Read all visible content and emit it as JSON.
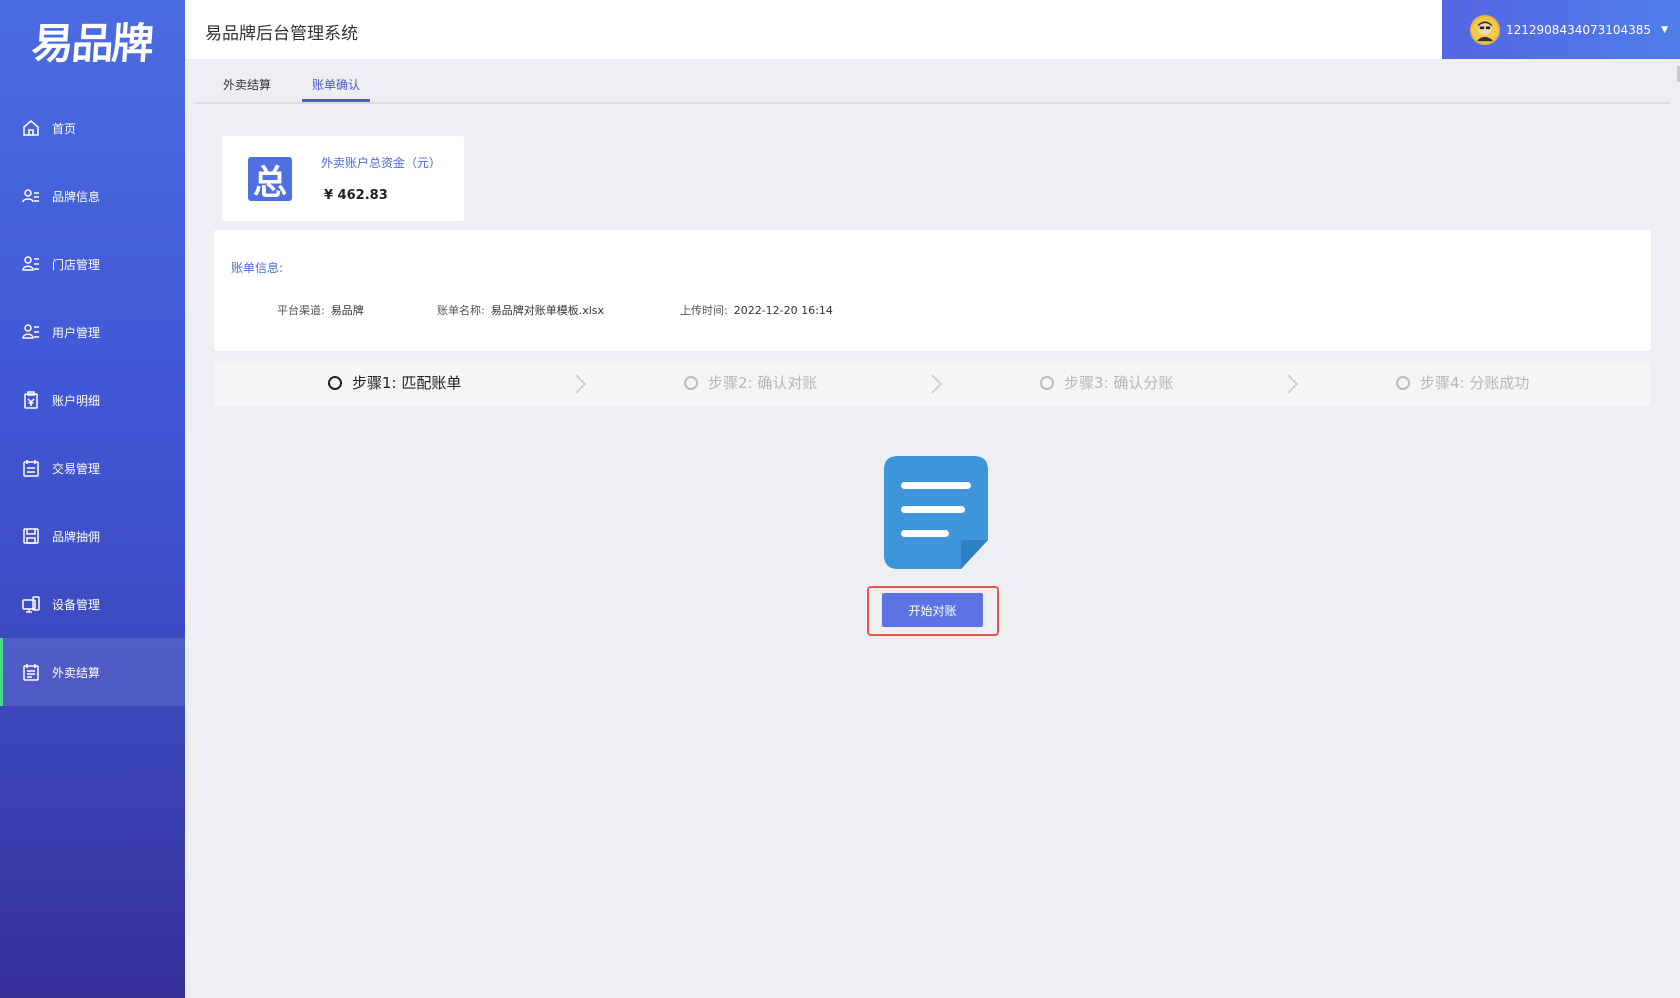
{
  "sidebar": {
    "logo": "易品牌",
    "items": [
      {
        "label": "首页",
        "icon": "home-icon"
      },
      {
        "label": "品牌信息",
        "icon": "brand-info-icon"
      },
      {
        "label": "门店管理",
        "icon": "store-icon"
      },
      {
        "label": "用户管理",
        "icon": "user-icon"
      },
      {
        "label": "账户明细",
        "icon": "account-icon"
      },
      {
        "label": "交易管理",
        "icon": "transaction-icon"
      },
      {
        "label": "品牌抽佣",
        "icon": "commission-icon"
      },
      {
        "label": "设备管理",
        "icon": "device-icon"
      },
      {
        "label": "外卖结算",
        "icon": "settlement-icon"
      }
    ],
    "active_index": 8
  },
  "header": {
    "title": "易品牌后台管理系统",
    "user_id": "1212908434073104385"
  },
  "tabs": [
    {
      "label": "外卖结算"
    },
    {
      "label": "账单确认"
    }
  ],
  "active_tab": 1,
  "fund_card": {
    "icon_char": "总",
    "label": "外卖账户总资金（元）",
    "value": "¥ 462.83"
  },
  "bill_info": {
    "heading": "账单信息:",
    "platform_label": "平台渠道:",
    "platform_value": "易品牌",
    "name_label": "账单名称:",
    "name_value": "易品牌对账单模板.xlsx",
    "time_label": "上传时间:",
    "time_value": "2022-12-20 16:14"
  },
  "steps": [
    {
      "label": "步骤1: 匹配账单",
      "state": "current"
    },
    {
      "label": "步骤2: 确认对账",
      "state": "pending"
    },
    {
      "label": "步骤3: 确认分账",
      "state": "pending"
    },
    {
      "label": "步骤4: 分账成功",
      "state": "pending"
    }
  ],
  "start_button": "开始对账",
  "colors": {
    "sidebar_top": "#4a6de0",
    "sidebar_bottom": "#362f98",
    "accent": "#4a5ad8",
    "doc_icon": "#3f95dc",
    "highlight": "#e05a4a",
    "button": "#5b73e3"
  }
}
